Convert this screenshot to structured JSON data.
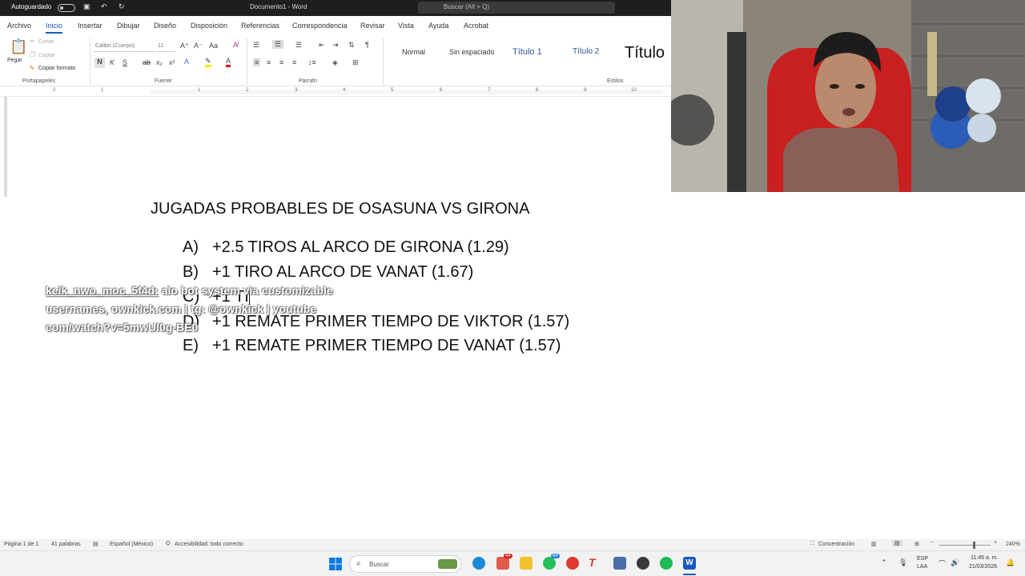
{
  "titlebar": {
    "autosave_label": "Autoguardado",
    "doc_title": "Documento1 - Word",
    "search_placeholder": "Buscar (Alt + Q)"
  },
  "ribbon": {
    "tabs": [
      "Archivo",
      "Inicio",
      "Insertar",
      "Dibujar",
      "Diseño",
      "Disposición",
      "Referencias",
      "Correspondencia",
      "Revisar",
      "Vista",
      "Ayuda",
      "Acrobat"
    ],
    "active_tab": "Inicio",
    "clipboard": {
      "paste": "Pegar",
      "cut": "Cortar",
      "copy": "Copiar",
      "format_painter": "Copiar formato",
      "label": "Portapapeles"
    },
    "font": {
      "name": "Calibri (Cuerpo)",
      "size": "11",
      "bold": "N",
      "italic": "K",
      "underline": "S",
      "label": "Fuente"
    },
    "paragraph_label": "Párrafo",
    "styles": {
      "items": [
        "Normal",
        "Sin espaciado",
        "Título 1",
        "Título 2",
        "Título"
      ],
      "label": "Estilos"
    }
  },
  "ruler": {
    "numbers": [
      "2",
      "1",
      "1",
      "2",
      "3",
      "4",
      "5",
      "6",
      "7",
      "8",
      "9",
      "10"
    ]
  },
  "document": {
    "title": "JUGADAS PROBABLES DE OSASUNA VS GIRONA",
    "items": [
      {
        "letter": "A)",
        "text": "+2.5 TIROS AL ARCO DE GIRONA (1.29)"
      },
      {
        "letter": "B)",
        "text": "+1 TIRO AL ARCO DE VANAT (1.67)"
      },
      {
        "letter": "C)",
        "text": "+1 TI"
      },
      {
        "letter": "D)",
        "text": "+1 REMATE PRIMER TIEMPO DE VIKTOR (1.57)"
      },
      {
        "letter": "E)",
        "text": "+1 REMATE PRIMER TIEMPO DE VANAT (1.57)"
      }
    ]
  },
  "overlay": {
    "username": "keik_nwo_moc_5f4d:",
    "message_line1": " alo bot system via customizable",
    "message_line2": "usernames, ownkick.com | tg: @ownkick | youtube",
    "message_line3": "com/watch?v=5mwUl0g-BE0"
  },
  "statusbar": {
    "page": "Página 1 de 1",
    "words": "41 palabras",
    "language": "Español (México)",
    "accessibility": "Accesibilidad: todo correcto",
    "focus": "Concentración",
    "zoom": "240%"
  },
  "taskbar": {
    "search_placeholder": "Buscar",
    "badge_mail": "44",
    "badge_whatsapp": "64",
    "lang_top": "ESP",
    "lang_bottom": "LAA",
    "time": "11:45 a. m.",
    "date": "21/03/2026"
  },
  "colors": {
    "accent": "#185abd",
    "titlebar": "#1e1e1e",
    "statusbar": "#f3f3f3"
  }
}
